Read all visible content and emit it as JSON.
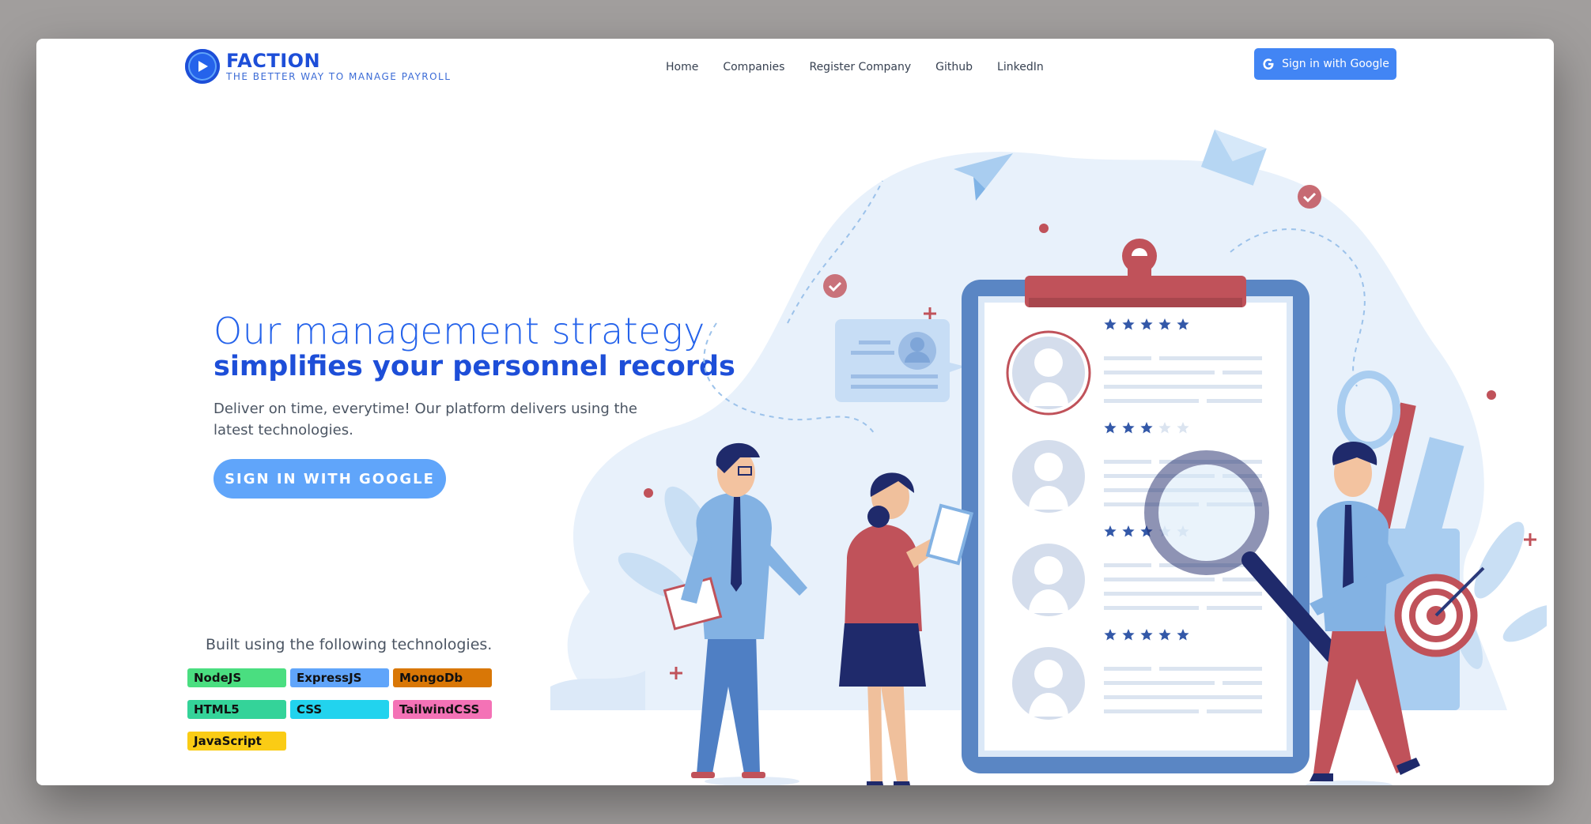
{
  "header": {
    "brand": "FACTION",
    "tagline": "THE BETTER WAY TO MANAGE PAYROLL",
    "nav": [
      "Home",
      "Companies",
      "Register Company",
      "Github",
      "LinkedIn"
    ],
    "signin_label": "Sign in with Google"
  },
  "hero": {
    "title_light": "Our management strategy",
    "title_bold": "simplifies your personnel records",
    "description": "Deliver on time, everytime! Our platform delivers using the latest technologies.",
    "cta": "SIGN IN WITH GOOGLE"
  },
  "tech": {
    "title": "Built using the following technologies.",
    "items": [
      {
        "label": "NodeJS",
        "color": "#4ade80"
      },
      {
        "label": "ExpressJS",
        "color": "#60a5fa"
      },
      {
        "label": "MongoDb",
        "color": "#d97706"
      },
      {
        "label": "HTML5",
        "color": "#34d399"
      },
      {
        "label": "CSS",
        "color": "#22d3ee"
      },
      {
        "label": "TailwindCSS",
        "color": "#f472b6"
      },
      {
        "label": "JavaScript",
        "color": "#facc15"
      }
    ]
  },
  "illustration": {
    "ratings": [
      5,
      3,
      3,
      5
    ]
  },
  "colors": {
    "primary": "#2563eb",
    "primary_dark": "#1d4ed8",
    "google_blue": "#4285f4",
    "cta_blue": "#60a5fa",
    "accent_red": "#c0525a"
  }
}
